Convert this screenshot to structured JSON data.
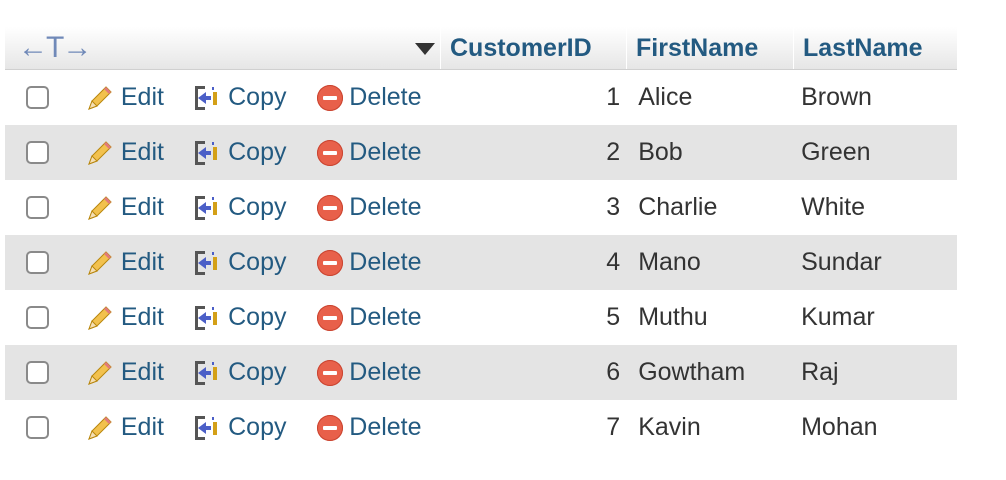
{
  "header": {
    "columns": [
      "CustomerID",
      "FirstName",
      "LastName"
    ],
    "resize_arrows": "←T→"
  },
  "actions": {
    "edit": "Edit",
    "copy": "Copy",
    "delete": "Delete"
  },
  "colors": {
    "link": "#235a81",
    "row_alt": "#e4e4e4",
    "delete": "#e8604a"
  },
  "rows": [
    {
      "id": "1",
      "first": "Alice",
      "last": "Brown"
    },
    {
      "id": "2",
      "first": "Bob",
      "last": "Green"
    },
    {
      "id": "3",
      "first": "Charlie",
      "last": "White"
    },
    {
      "id": "4",
      "first": "Mano",
      "last": "Sundar"
    },
    {
      "id": "5",
      "first": "Muthu",
      "last": "Kumar"
    },
    {
      "id": "6",
      "first": "Gowtham",
      "last": "Raj"
    },
    {
      "id": "7",
      "first": "Kavin",
      "last": "Mohan"
    }
  ]
}
